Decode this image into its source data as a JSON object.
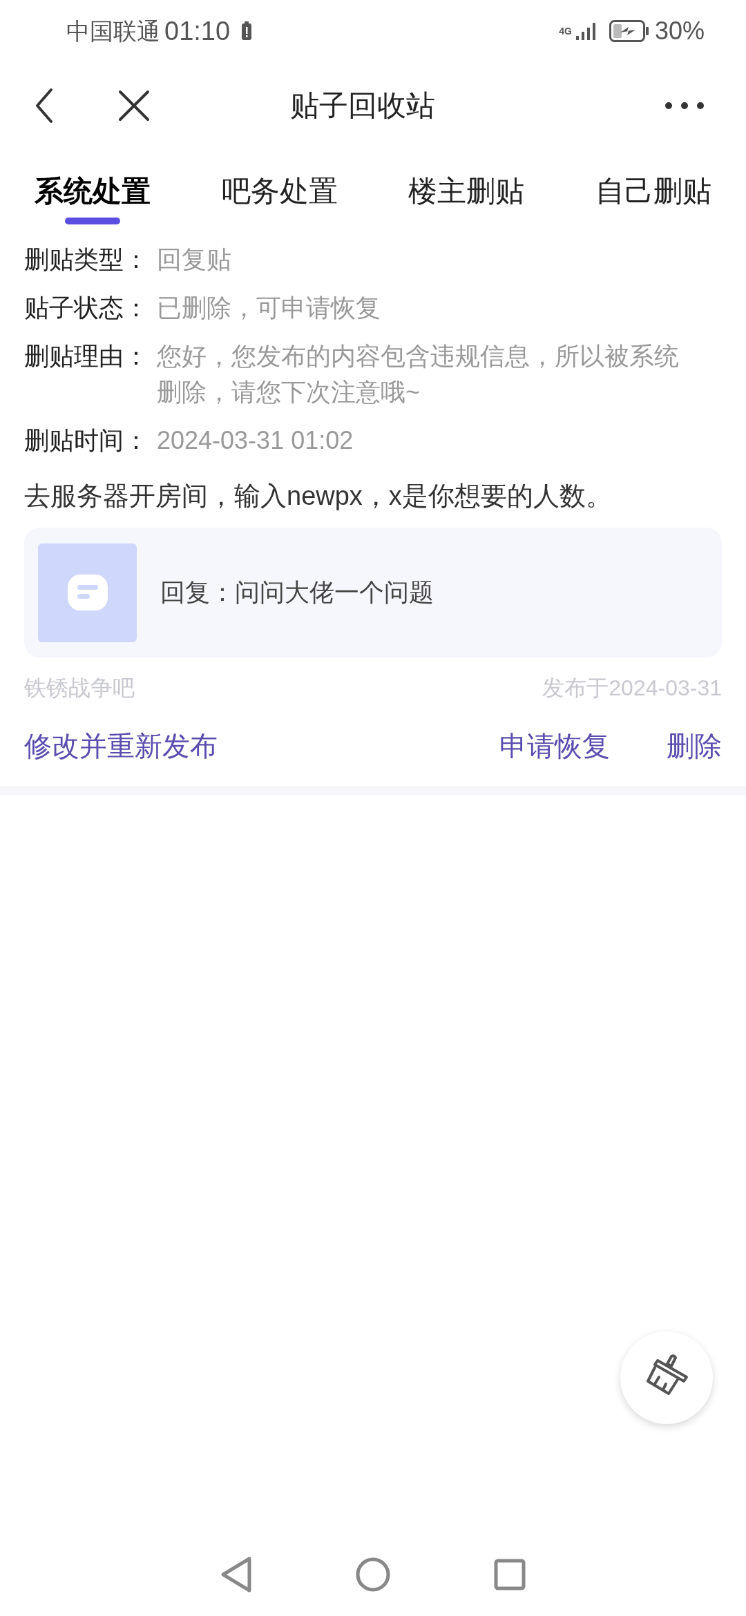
{
  "status_bar": {
    "carrier": "中国联通",
    "time": "01:10",
    "network": "4G",
    "battery": "30%"
  },
  "header": {
    "title": "贴子回收站"
  },
  "tabs": [
    {
      "label": "系统处置",
      "selected": true
    },
    {
      "label": "吧务处置",
      "selected": false
    },
    {
      "label": "楼主删贴",
      "selected": false
    },
    {
      "label": "自己删贴",
      "selected": false
    }
  ],
  "details": [
    {
      "label": "删贴类型：",
      "value": "回复贴"
    },
    {
      "label": "贴子状态：",
      "value": "已删除，可申请恢复"
    },
    {
      "label": "删贴理由：",
      "value": "您好，您发布的内容包含违规信息，所以被系统删除，请您下次注意哦~"
    },
    {
      "label": "删贴时间：",
      "value": "2024-03-31 01:02"
    }
  ],
  "content": "去服务器开房间，输入newpx，x是你想要的人数。",
  "card": {
    "text": "回复：问问大佬一个问题"
  },
  "meta": {
    "forum": "铁锈战争吧",
    "published": "发布于2024-03-31"
  },
  "actions": [
    "修改并重新发布",
    "申请恢复",
    "删除"
  ]
}
